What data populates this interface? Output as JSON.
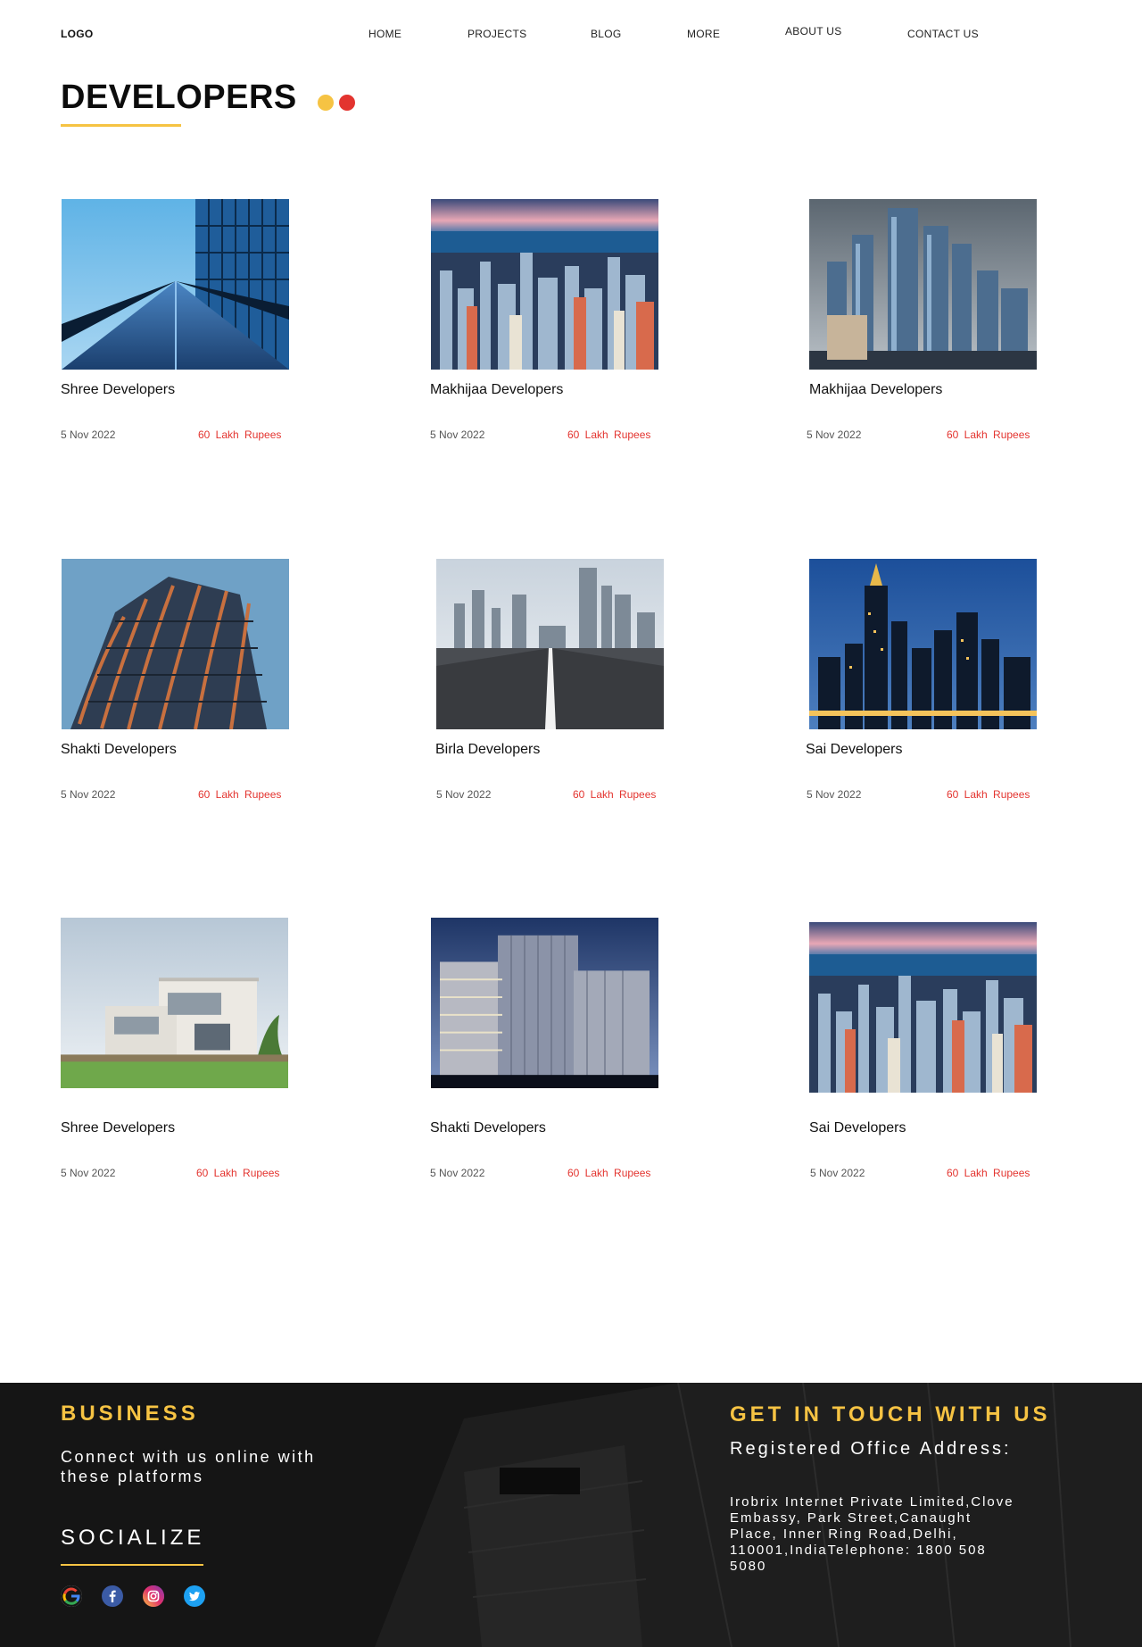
{
  "header": {
    "logo": "LOGO",
    "nav": [
      "HOME",
      "PROJECTS",
      "BLOG",
      "MORE",
      "ABOUT US",
      "CONTACT US"
    ]
  },
  "page": {
    "title": "DEVELOPERS"
  },
  "cards": [
    {
      "name": "Shree Developers",
      "date": "5 Nov 2022",
      "price": "60 Lakh Rupees",
      "image": "glass-tower-perspective"
    },
    {
      "name": "Makhijaa Developers",
      "date": "5 Nov 2022",
      "price": "60 Lakh Rupees",
      "image": "city-skyline-aerial"
    },
    {
      "name": "Makhijaa Developers",
      "date": "5 Nov 2022",
      "price": "60 Lakh Rupees",
      "image": "skyscrapers-cloudy"
    },
    {
      "name": "Shakti Developers",
      "date": "5 Nov 2022",
      "price": "60 Lakh Rupees",
      "image": "curved-building"
    },
    {
      "name": "Birla Developers",
      "date": "5 Nov 2022",
      "price": "60 Lakh Rupees",
      "image": "road-to-city"
    },
    {
      "name": "Sai Developers",
      "date": "5 Nov 2022",
      "price": "60 Lakh Rupees",
      "image": "night-skyline"
    },
    {
      "name": "Shree Developers",
      "date": "5 Nov 2022",
      "price": "60 Lakh Rupees",
      "image": "modern-villa"
    },
    {
      "name": "Shakti Developers",
      "date": "5 Nov 2022",
      "price": "60 Lakh Rupees",
      "image": "glass-office-buildings"
    },
    {
      "name": "Sai Developers",
      "date": "5 Nov 2022",
      "price": "60 Lakh Rupees",
      "image": "city-skyline-aerial"
    }
  ],
  "footer": {
    "business_heading": "BUSINESS",
    "connect_text": "Connect with us online with these platforms",
    "socialize_heading": "SOCIALIZE",
    "social_icons": [
      "google-icon",
      "facebook-icon",
      "instagram-icon",
      "twitter-icon"
    ],
    "touch_heading": "GET IN TOUCH WITH US",
    "registered_label": "Registered Office Address:",
    "address": "Irobrix Internet Private Limited,Clove Embassy, Park Street,Canaught Place, Inner Ring Road,Delhi, 110001,IndiaTelephone: 1800 508 5080"
  },
  "colors": {
    "accent_yellow": "#f6c343",
    "accent_red": "#e3342f",
    "footer_bg": "#151515"
  }
}
